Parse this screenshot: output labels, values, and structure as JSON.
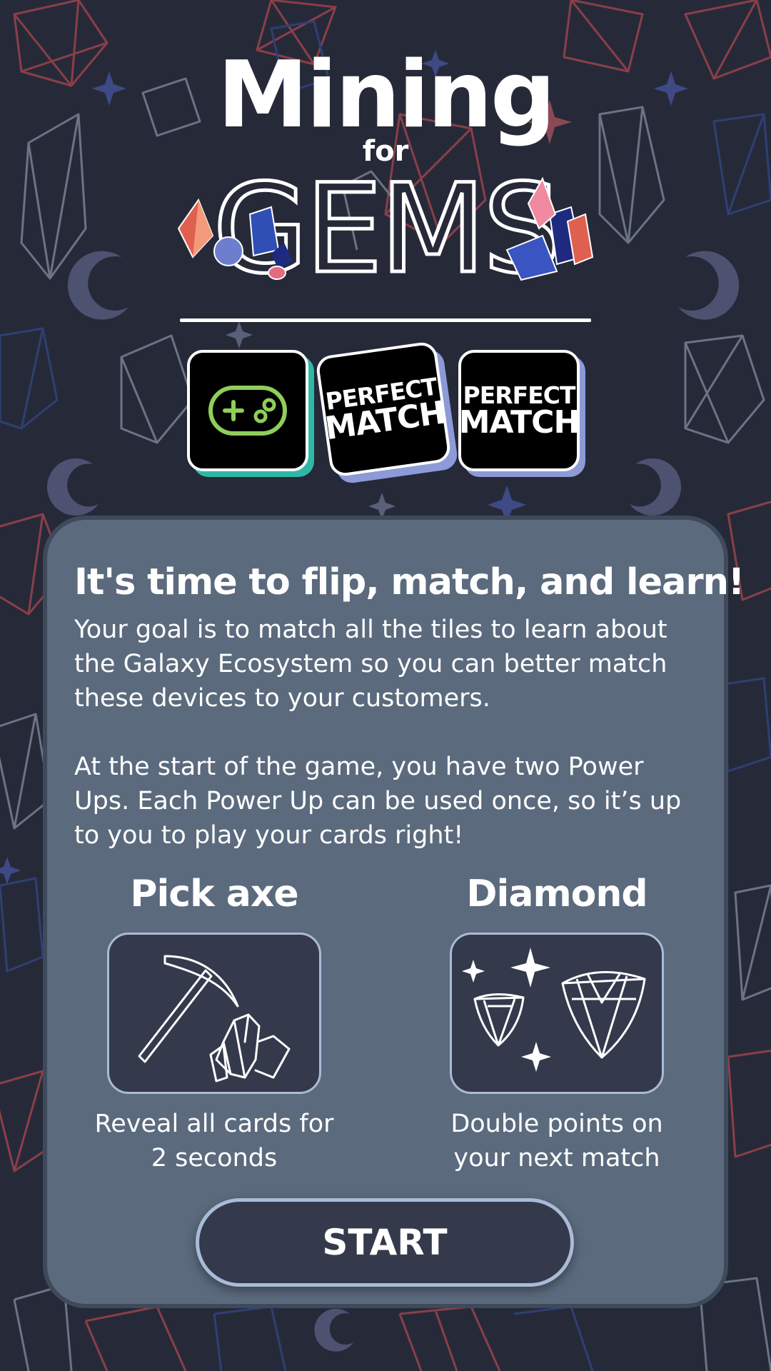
{
  "colors": {
    "background": "#262a38",
    "panel": "#5b6a7d",
    "panel_border": "#3e4a5c",
    "box": "#343a4b",
    "box_border": "#a9bbd7",
    "gamepad_green": "#8fce5a",
    "tile_shadow_teal": "#2fb8a6",
    "tile_shadow_lavender": "#8d9ad8"
  },
  "title": {
    "line1": "Mining",
    "line2": "for",
    "line3": "GEMS"
  },
  "tiles": [
    {
      "icon": "gamepad-icon"
    },
    {
      "line1": "PERFECT",
      "line2": "MATCH"
    },
    {
      "line1": "PERFECT",
      "line2": "MATCH"
    }
  ],
  "intro": {
    "heading": "It's time to flip, match, and learn!",
    "paragraph1": "Your goal is to match all the tiles to learn about the Galaxy Ecosystem so you can better match these devices to your customers.",
    "paragraph2": "At the start of the game, you have two Power Ups. Each Power Up can be used once, so it’s up to you to play your cards right!"
  },
  "powerups": [
    {
      "title": "Pick axe",
      "icon": "pickaxe-icon",
      "description": "Reveal all cards for 2 seconds"
    },
    {
      "title": "Diamond",
      "icon": "diamond-icon",
      "description": "Double points on your next match"
    }
  ],
  "start_button": {
    "label": "START"
  }
}
